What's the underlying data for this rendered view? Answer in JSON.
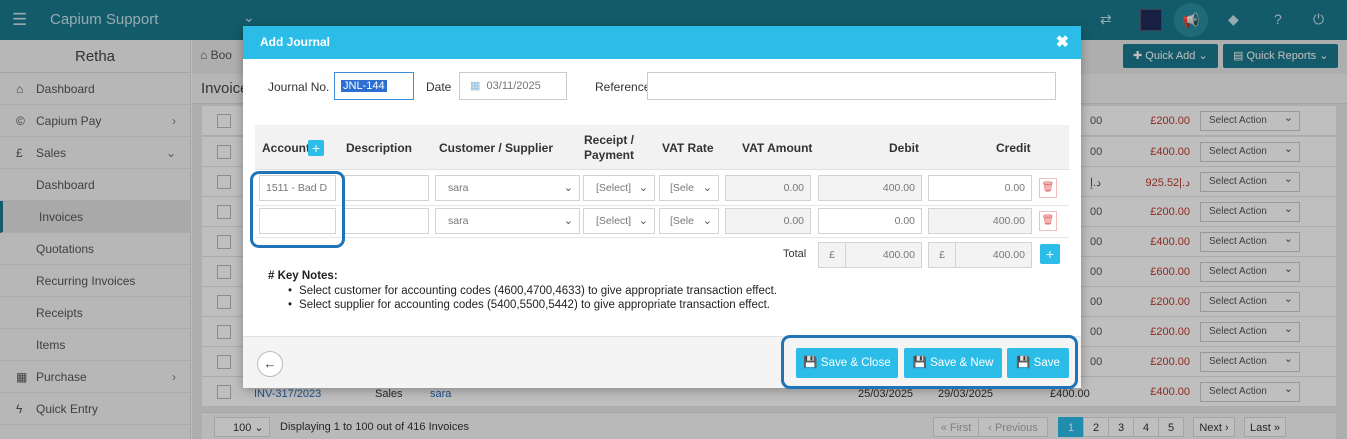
{
  "app": {
    "title": "Capium Support",
    "org": "Retha"
  },
  "topbar": {
    "icons": [
      "menu-icon",
      "exchange-icon",
      "megaphone-icon",
      "tag-icon",
      "help-icon",
      "power-icon"
    ]
  },
  "sidebar": {
    "items": [
      {
        "label": "Dashboard",
        "icon": "home-icon"
      },
      {
        "label": "Capium Pay",
        "icon": "coin-icon"
      },
      {
        "label": "Sales",
        "icon": "pound-icon"
      },
      {
        "label": "Dashboard"
      },
      {
        "label": "Invoices"
      },
      {
        "label": "Quotations"
      },
      {
        "label": "Recurring Invoices"
      },
      {
        "label": "Receipts"
      },
      {
        "label": "Items"
      },
      {
        "label": "Purchase",
        "icon": "calculator-icon"
      },
      {
        "label": "Quick Entry",
        "icon": "bolt-icon"
      }
    ]
  },
  "main": {
    "breadcrumb": "Boo",
    "quick_add": "Quick Add",
    "quick_reports": "Quick Reports",
    "section_title": "Invoice",
    "rows": [
      {
        "num": "00",
        "amount": "£200.00",
        "action": "Select Action"
      },
      {
        "num": "00",
        "amount": "£400.00",
        "action": "Select Action"
      },
      {
        "num": "د.إ",
        "amount": "925.52|.د",
        "action": "Select Action"
      },
      {
        "num": "00",
        "amount": "£200.00",
        "action": "Select Action"
      },
      {
        "num": "00",
        "amount": "£400.00",
        "action": "Select Action"
      },
      {
        "num": "00",
        "amount": "£600.00",
        "action": "Select Action"
      },
      {
        "num": "00",
        "amount": "£200.00",
        "action": "Select Action"
      },
      {
        "num": "00",
        "amount": "£200.00",
        "action": "Select Action"
      },
      {
        "num": "00",
        "amount": "£200.00",
        "action": "Select Action"
      }
    ],
    "last_row": {
      "invoice": "INV-317/2023",
      "type": "Sales",
      "customer": "sara",
      "date1": "25/03/2025",
      "date2": "29/03/2025",
      "amount": "£400.00",
      "amount_alt": "£400.00",
      "action": "Select Action"
    },
    "pager": {
      "per_page": "100",
      "info": "Displaying 1 to 100 out of 416 Invoices",
      "first": "« First",
      "prev": "‹ Previous",
      "pages": [
        "1",
        "2",
        "3",
        "4",
        "5"
      ],
      "next": "Next ›",
      "last": "Last »"
    }
  },
  "modal": {
    "title": "Add Journal",
    "journal_no_label": "Journal No.",
    "journal_no": "JNL-144",
    "date_label": "Date",
    "date": "03/11/2025",
    "reference_label": "Reference",
    "columns": [
      "Account",
      "Description",
      "Customer / Supplier",
      "Receipt / Payment",
      "VAT Rate",
      "VAT Amount",
      "Debit",
      "Credit"
    ],
    "lines": [
      {
        "account": "1511 - Bad D",
        "description": "",
        "customer": "sara",
        "receipt": "[Select]",
        "vat_rate": "[Sele",
        "vat_amount": "0.00",
        "debit": "400.00",
        "credit": "0.00"
      },
      {
        "account": "",
        "description": "",
        "customer": "sara",
        "receipt": "[Select]",
        "vat_rate": "[Sele",
        "vat_amount": "0.00",
        "debit": "0.00",
        "credit": "400.00"
      }
    ],
    "total_label": "Total",
    "currency": "£",
    "total_debit": "400.00",
    "total_credit": "400.00",
    "notes_title": "# Key Notes:",
    "notes": [
      "Select customer for accounting codes (4600,4700,4633) to give appropriate transaction effect.",
      "Select supplier for accounting codes (5400,5500,5442) to give appropriate transaction effect."
    ],
    "buttons": {
      "save_close": "Save & Close",
      "save_new": "Save & New",
      "save": "Save"
    }
  },
  "colors": {
    "topbar": "#1a7a8e",
    "modal_header": "#2bbde8",
    "highlight": "#1f73b7"
  }
}
